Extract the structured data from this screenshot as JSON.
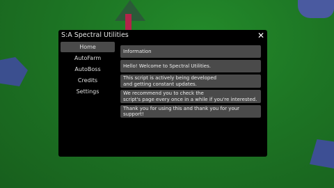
{
  "window": {
    "title": "S:A Spectral Utilities",
    "close_label": "✕"
  },
  "sidebar": {
    "items": [
      {
        "label": "Home"
      },
      {
        "label": "AutoFarm"
      },
      {
        "label": "AutoBoss"
      },
      {
        "label": "Credits"
      },
      {
        "label": "Settings"
      }
    ],
    "active": "Home"
  },
  "content": {
    "header": "Information",
    "cards": [
      "Hello! Welcome to Spectral Utilities.",
      "This script is actively being developed\nand getting constant updates.",
      "We recommend you to check the\nscript's page every once in a while if you're interested.",
      "Thank you for using this and thank you for your support!"
    ]
  },
  "colors": {
    "window_bg": "#000000",
    "item_bg": "#4a4a4a",
    "text": "#eeeeee",
    "ground": "#1d7524"
  }
}
